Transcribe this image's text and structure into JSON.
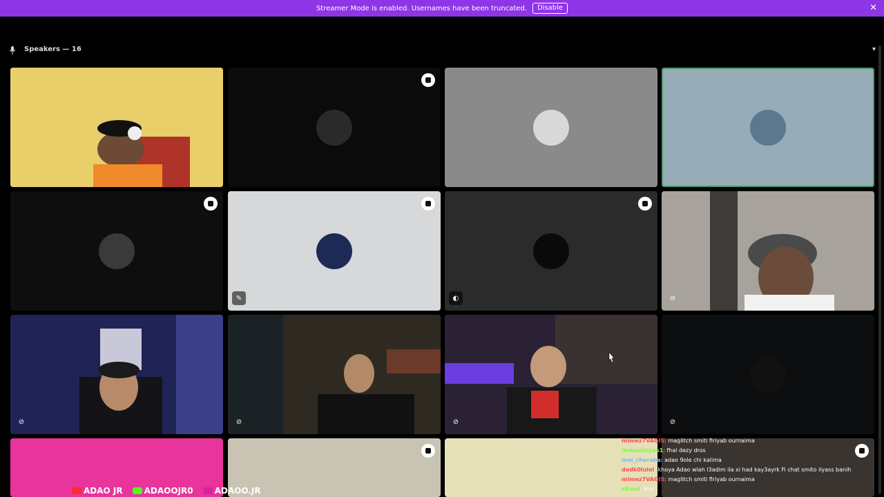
{
  "banner": {
    "message": "Streamer Mode is enabled. Usernames have been truncated.",
    "disable_label": "Disable"
  },
  "section": {
    "title": "Speakers — 16"
  },
  "tiles": [
    {
      "type": "video",
      "speaking": true,
      "bg": "#e2c65e"
    },
    {
      "type": "avatar",
      "bg": "#0b0b0b",
      "badge": true
    },
    {
      "type": "avatar",
      "bg": "#8a8a8a"
    },
    {
      "type": "avatar",
      "bg": "#98abb8",
      "speaking": true
    },
    {
      "type": "avatar",
      "bg": "#0e0e0e",
      "badge": true
    },
    {
      "type": "avatar",
      "bg": "#d6d8da",
      "badge": true,
      "status": "mic-off-icon"
    },
    {
      "type": "avatar",
      "bg": "#2b2b2b",
      "badge": true,
      "status": "camera-off-icon"
    },
    {
      "type": "video",
      "bg": "#5a5552",
      "status": "mic-off-icon"
    },
    {
      "type": "video",
      "bg": "#1a1d3d",
      "status": "mic-off-icon"
    },
    {
      "type": "video",
      "bg": "#232323",
      "status": "mic-off-icon"
    },
    {
      "type": "video",
      "bg": "#1c1a26",
      "status": "mic-off-icon"
    },
    {
      "type": "avatar",
      "bg": "#0c0e10",
      "status": "mic-off-icon"
    },
    {
      "type": "video",
      "bg": "#e8349b"
    },
    {
      "type": "avatar",
      "bg": "#c9c3b3",
      "badge": true
    },
    {
      "type": "avatar",
      "bg": "#e5e0b8"
    },
    {
      "type": "video",
      "bg": "#3a3430",
      "badge": true
    }
  ],
  "chat": [
    {
      "user": "mimez7VAGIS",
      "text": ": maglitch smiti flriyab ournaima",
      "color": "#ff4d4d"
    },
    {
      "user": "instauhilyas1",
      "text": ": fhal dezy dros",
      "color": "#7cfc3a"
    },
    {
      "user": "mol_cheraba",
      "text": ": adao 9ole chi kalima",
      "color": "#7ab8ff"
    },
    {
      "user": "dodk0lulol",
      "text": ": khoya Adao wlah l3adim ila xi had kay3ayrk Fi chat smito ilyass banih",
      "color": "#ff4d4d"
    },
    {
      "user": "mimez7VAGIS",
      "text": ": maglitch smiti flriyab ournaima",
      "color": "#ff4d4d"
    },
    {
      "user": "x9vml",
      "text": ": khri",
      "color": "#7cfc3a"
    }
  ],
  "socials": [
    {
      "label": "ADAO JR",
      "icon": "youtube-icon",
      "color": "#ff2a2a"
    },
    {
      "label": "ADAOOJR0",
      "icon": "kick-icon",
      "color": "#53fc18"
    },
    {
      "label": "ADAOO.JR",
      "icon": "instagram-icon",
      "color": "#d6249f"
    }
  ],
  "icons": {
    "banner_close": "close-icon",
    "section": "microphone-icon",
    "collapse": "chevron-down-icon"
  }
}
